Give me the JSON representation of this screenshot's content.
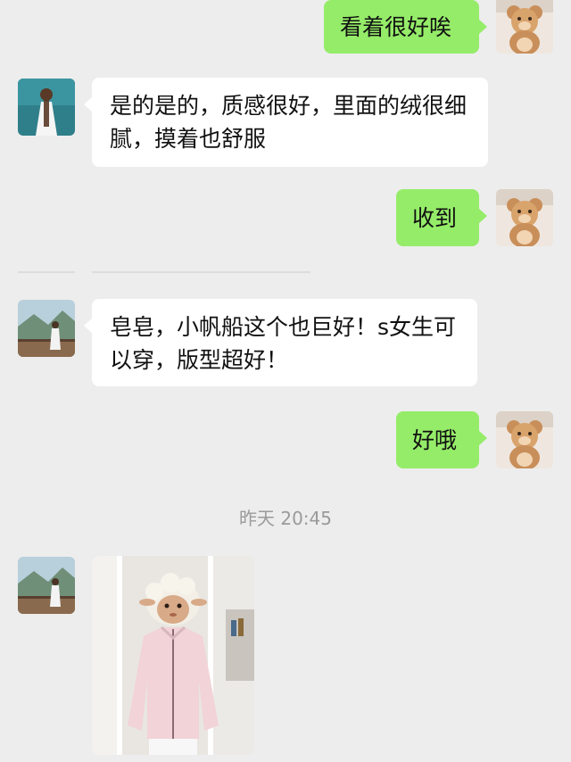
{
  "messages": [
    {
      "side": "right",
      "text": "看着很好唉"
    },
    {
      "side": "left",
      "text": "是的是的，质感很好，里面的绒很细腻，摸着也舒服"
    },
    {
      "side": "right",
      "text": "收到"
    },
    {
      "side": "left",
      "text": "皂皂，小帆船这个也巨好！s女生可以穿，版型超好！"
    },
    {
      "side": "right",
      "text": "好哦"
    }
  ],
  "timestamp": "昨天 20:45",
  "image_message": {
    "side": "left",
    "content": "photo of a person wearing a light pink zip-up jacket with a sheep-head sticker over the face"
  },
  "avatars": {
    "self": "teddy-bear-avatar",
    "contact_a": "person-in-white-dress-avatar",
    "contact_b": "mountain-landscape-avatar"
  },
  "colors": {
    "background": "#ededed",
    "bubble_left": "#ffffff",
    "bubble_right": "#95ec69",
    "timestamp_text": "#9a9a9a"
  }
}
